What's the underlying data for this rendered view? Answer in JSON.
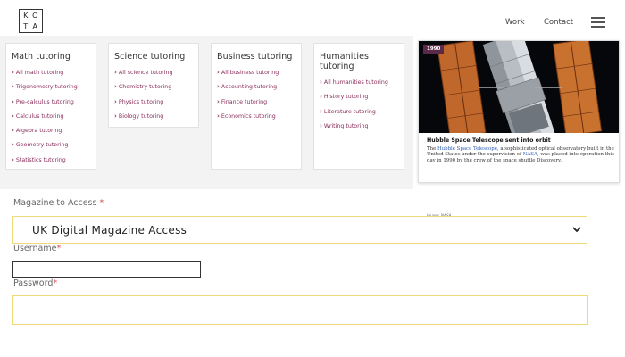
{
  "header": {
    "logo_letters": [
      "K",
      "O",
      "T",
      "A"
    ],
    "nav": {
      "work": "Work",
      "contact": "Contact"
    }
  },
  "tutoring": [
    {
      "title": "Math tutoring",
      "links": [
        "All math tutoring",
        "Trigonometry tutoring",
        "Pre-calculus tutoring",
        "Calculus tutoring",
        "Algebra tutoring",
        "Geometry tutoring",
        "Statistics tutoring"
      ]
    },
    {
      "title": "Science tutoring",
      "links": [
        "All science tutoring",
        "Chemistry tutoring",
        "Physics tutoring",
        "Biology tutoring"
      ]
    },
    {
      "title": "Business tutoring",
      "links": [
        "All business tutoring",
        "Accounting tutoring",
        "Finance tutoring",
        "Economics tutoring"
      ]
    },
    {
      "title": "Humanities tutoring",
      "links": [
        "All humanities tutoring",
        "History tutoring",
        "Literature tutoring",
        "Writing tutoring"
      ]
    }
  ],
  "news": {
    "badge": "1990",
    "title": "Hubble Space Telescope sent into orbit",
    "body_pre": "The ",
    "body_link1": "Hubble Space Telescope",
    "body_mid": ", a sophisticated optical observatory built in the United States under the supervision of ",
    "body_link2": "NASA",
    "body_post": ", was placed into operation this day in 1990 by the crew of the space shuttle Discovery.",
    "credit": "Image: NASA"
  },
  "form": {
    "magazine_label": "Magazine to Access",
    "magazine_value": "UK Digital Magazine Access",
    "username_label": "Username",
    "username_value": "",
    "password_label": "Password",
    "password_value": "",
    "required_mark": "*"
  },
  "colors": {
    "link": "#8a2c5a",
    "badge": "#5b2a4b",
    "field_border": "#f0d978",
    "required": "#d9534f"
  }
}
